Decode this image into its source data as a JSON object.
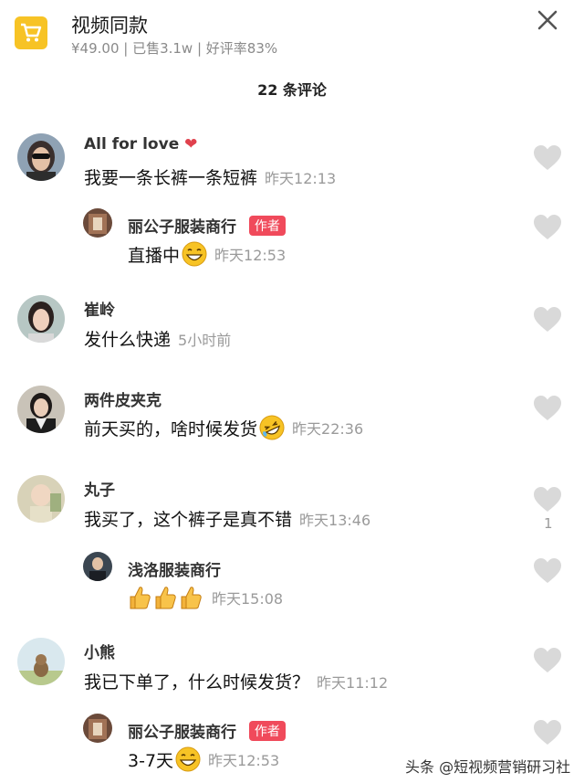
{
  "product": {
    "title": "视频同款",
    "meta": "¥49.00 | 已售3.1w | 好评率83%",
    "icon": "shopping-cart-icon",
    "accent": "#f7c325"
  },
  "comments_header": "22 条评论",
  "badge_label": "作者",
  "comments": [
    {
      "name": "All for love",
      "text": "我要一条长裤一条短裤",
      "time": "昨天12:13"
    },
    {
      "name": "丽公子服装商行",
      "text": "直播中",
      "time": "昨天12:53",
      "author": true
    },
    {
      "name": "崔岭",
      "text": "发什么快递",
      "time": "5小时前"
    },
    {
      "name": "两件皮夹克",
      "text": "前天买的，啥时候发货",
      "time": "昨天22:36"
    },
    {
      "name": "丸子",
      "text": "我买了，这个裤子是真不错",
      "time": "昨天13:46",
      "likes": "1"
    },
    {
      "name": "浅洛服装商行",
      "text": "",
      "time": "昨天15:08"
    },
    {
      "name": "小熊",
      "text": "我已下单了，什么时候发货？",
      "time": "昨天11:12"
    },
    {
      "name": "丽公子服装商行",
      "text": "3-7天",
      "time": "昨天12:53",
      "author": true
    }
  ],
  "watermark": "头条 @短视频营销研习社",
  "colors": {
    "badge": "#f04a5b",
    "time": "#9a9a9a",
    "heart": "#d9d9d9"
  }
}
